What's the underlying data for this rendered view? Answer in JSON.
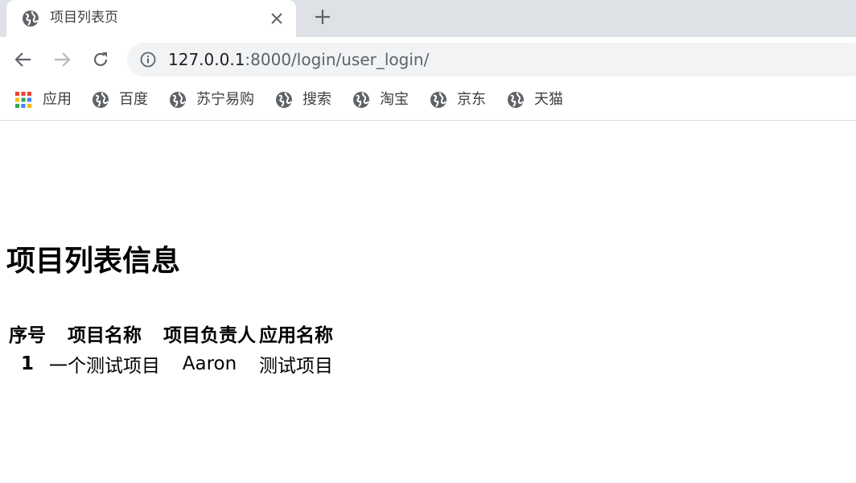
{
  "browser": {
    "tab": {
      "title": "项目列表页",
      "favicon": "globe-icon"
    },
    "address": {
      "host": "127.0.0.1",
      "rest": ":8000/login/user_login/"
    },
    "bookmarks": [
      {
        "label": "应用",
        "icon": "apps-grid-icon"
      },
      {
        "label": "百度",
        "icon": "globe-icon"
      },
      {
        "label": "苏宁易购",
        "icon": "globe-icon"
      },
      {
        "label": "搜索",
        "icon": "globe-icon"
      },
      {
        "label": "淘宝",
        "icon": "globe-icon"
      },
      {
        "label": "京东",
        "icon": "globe-icon"
      },
      {
        "label": "天猫",
        "icon": "globe-icon"
      }
    ],
    "colors": {
      "tabstrip": "#dee1e6",
      "omnibox": "#f1f3f4",
      "icon": "#5f6368"
    }
  },
  "page": {
    "title": "项目列表信息",
    "table": {
      "headers": [
        "序号",
        "项目名称",
        "项目负责人",
        "应用名称"
      ],
      "rows": [
        [
          "1",
          "一个测试项目",
          "Aaron",
          "测试项目"
        ]
      ]
    }
  }
}
